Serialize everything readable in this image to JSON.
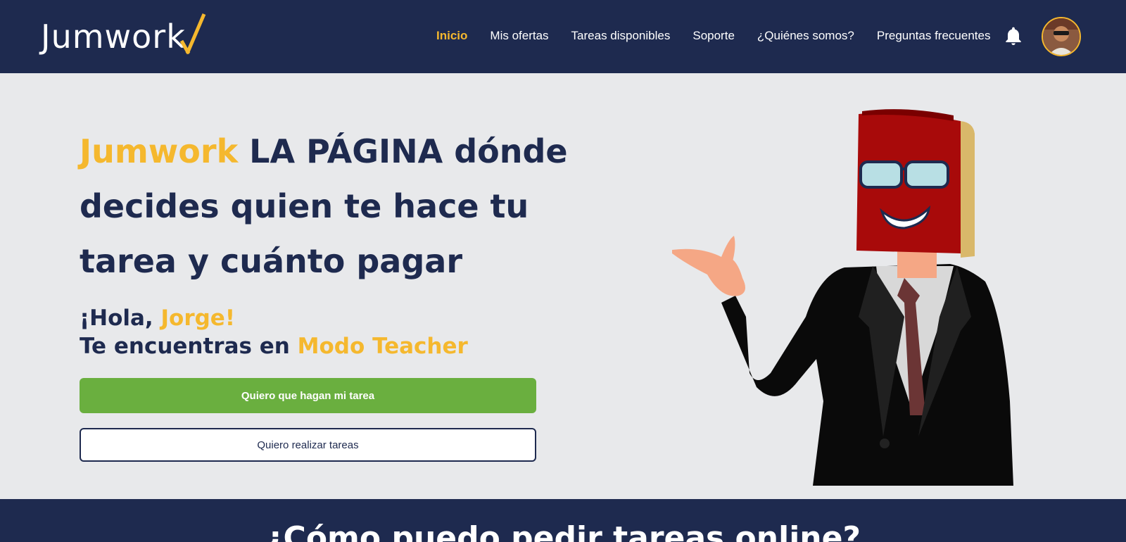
{
  "brand": {
    "logo_text": "Jumwork",
    "accent": "#f5b82e",
    "navy": "#1e2a4f",
    "green": "#6aaf3f"
  },
  "nav": {
    "items": [
      {
        "label": "Inicio",
        "active": true
      },
      {
        "label": "Mis ofertas"
      },
      {
        "label": "Tareas disponibles"
      },
      {
        "label": "Soporte"
      },
      {
        "label": "¿Quiénes somos?"
      },
      {
        "label": "Preguntas frecuentes"
      }
    ],
    "bell_icon": "bell-icon",
    "avatar_icon": "user-avatar"
  },
  "hero": {
    "brand_word": "Jumwork",
    "title_rest": " LA PÁGINA dónde decides quien te hace tu tarea y cuánto pagar",
    "greeting_prefix": "¡Hola, ",
    "user_name": "Jorge!",
    "mode_prefix": "Te encuentras en ",
    "mode_name": "Modo Teacher",
    "btn_primary": "Quiero que hagan mi tarea",
    "btn_secondary": "Quiero realizar tareas"
  },
  "section": {
    "title": "¿Cómo puedo pedir tareas online?"
  }
}
